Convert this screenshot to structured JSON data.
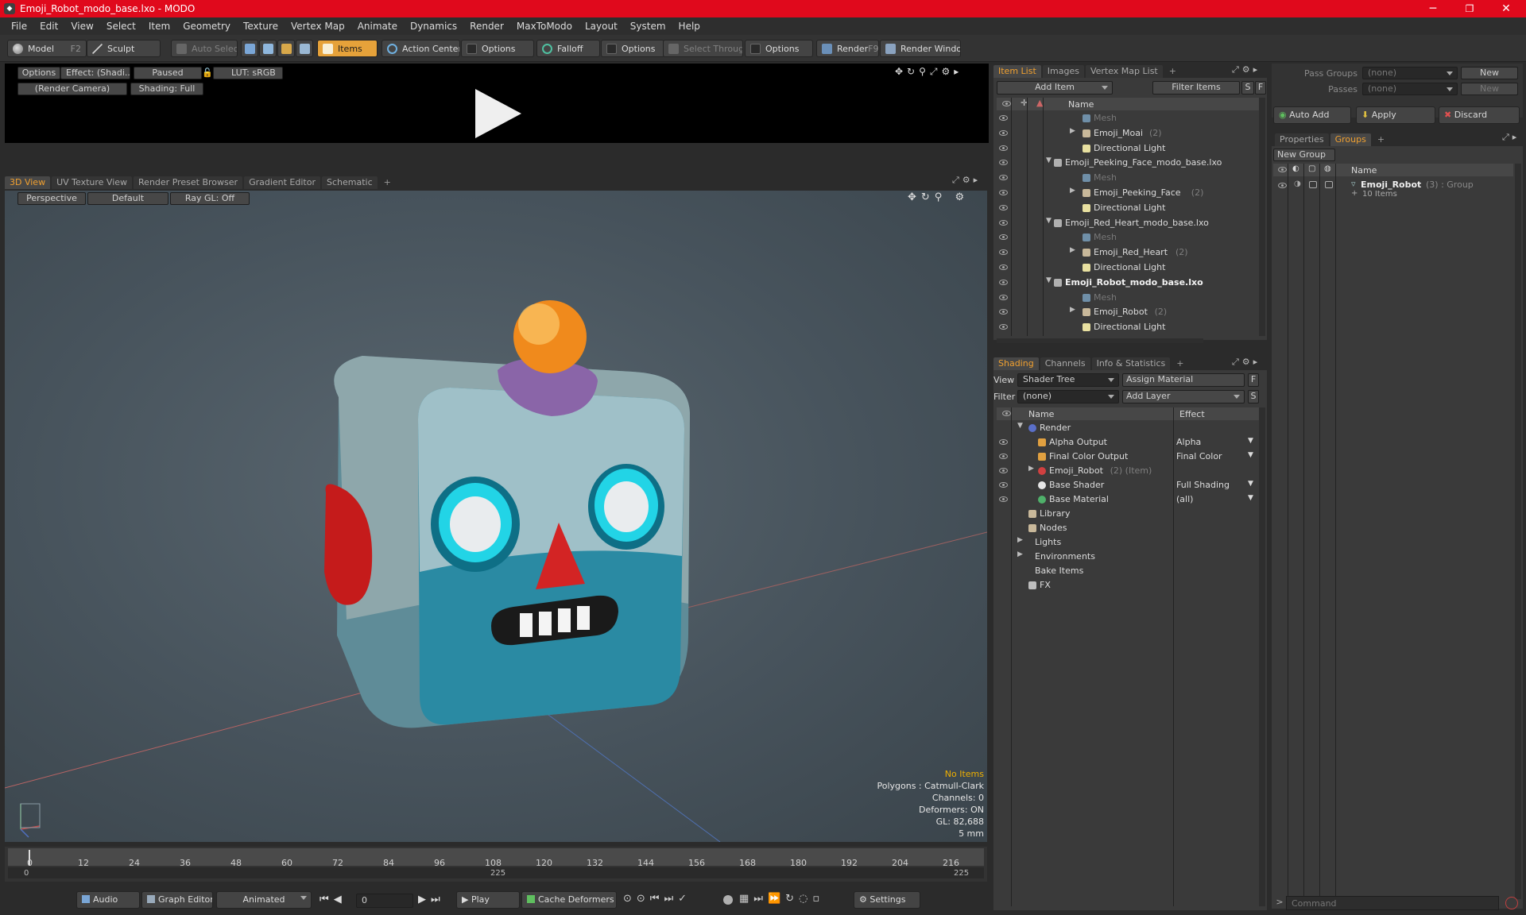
{
  "window": {
    "title": "Emoji_Robot_modo_base.lxo - MODO",
    "minimize": "─",
    "maximize": "❐",
    "close": "✕"
  },
  "menu": [
    "File",
    "Edit",
    "View",
    "Select",
    "Item",
    "Geometry",
    "Texture",
    "Vertex Map",
    "Animate",
    "Dynamics",
    "Render",
    "MaxToModo",
    "Layout",
    "System",
    "Help"
  ],
  "toolbar": {
    "model": "Model",
    "model_key": "F2",
    "sculpt": "Sculpt",
    "auto_select": "Auto Select",
    "items": "Items",
    "action_center": "Action Center",
    "options1": "Options",
    "falloff": "Falloff",
    "options2": "Options",
    "select_through": "Select Through",
    "options3": "Options",
    "render": "Render",
    "render_key": "F9",
    "render_window": "Render Window"
  },
  "preview": {
    "options": "Options",
    "effect": "Effect: (Shadi...",
    "paused": "Paused",
    "lut": "LUT: sRGB",
    "camera": "(Render Camera)",
    "shading": "Shading: Full"
  },
  "viewport_tabs": [
    "3D View",
    "UV Texture View",
    "Render Preset Browser",
    "Gradient Editor",
    "Schematic",
    "+"
  ],
  "viewport": {
    "perspective": "Perspective",
    "default": "Default",
    "raygl": "Ray GL: Off",
    "hud": {
      "no_items": "No Items",
      "polygons": "Polygons : Catmull-Clark",
      "channels": "Channels: 0",
      "deformers": "Deformers: ON",
      "gl": "GL: 82,688",
      "scale": "5 mm"
    }
  },
  "timeline": {
    "ticks": [
      "0",
      "12",
      "24",
      "36",
      "48",
      "60",
      "72",
      "84",
      "96",
      "108",
      "120",
      "132",
      "144",
      "156",
      "168",
      "180",
      "192",
      "204",
      "216"
    ],
    "start": "0",
    "mid": "225",
    "end": "225"
  },
  "bottom": {
    "audio": "Audio",
    "graph_editor": "Graph Editor",
    "animated": "Animated",
    "frame": "0",
    "play": "Play",
    "cache": "Cache Deformers",
    "settings": "Settings"
  },
  "item_list": {
    "tabs": [
      "Item List",
      "Images",
      "Vertex Map List",
      "+"
    ],
    "add_item": "Add Item",
    "filter_items": "Filter Items",
    "s": "S",
    "f": "F",
    "col_name": "Name",
    "rows": [
      {
        "label": "Mesh",
        "indent": 2,
        "kind": "mesh",
        "gray": true
      },
      {
        "label": "Emoji_Moai",
        "suffix": "(2)",
        "indent": 2,
        "kind": "group",
        "arrow": true
      },
      {
        "label": "Directional Light",
        "indent": 2,
        "kind": "light"
      },
      {
        "label": "Emoji_Peeking_Face_modo_base.lxo",
        "indent": 1,
        "kind": "scene",
        "open": true
      },
      {
        "label": "Mesh",
        "indent": 2,
        "kind": "mesh",
        "gray": true
      },
      {
        "label": "Emoji_Peeking_Face",
        "suffix": "(2)",
        "indent": 2,
        "kind": "group",
        "arrow": true
      },
      {
        "label": "Directional Light",
        "indent": 2,
        "kind": "light"
      },
      {
        "label": "Emoji_Red_Heart_modo_base.lxo",
        "indent": 1,
        "kind": "scene",
        "open": true
      },
      {
        "label": "Mesh",
        "indent": 2,
        "kind": "mesh",
        "gray": true
      },
      {
        "label": "Emoji_Red_Heart",
        "suffix": "(2)",
        "indent": 2,
        "kind": "group",
        "arrow": true
      },
      {
        "label": "Directional Light",
        "indent": 2,
        "kind": "light"
      },
      {
        "label": "Emoji_Robot_modo_base.lxo",
        "indent": 1,
        "kind": "scene",
        "open": true,
        "bold": true
      },
      {
        "label": "Mesh",
        "indent": 2,
        "kind": "mesh",
        "gray": true
      },
      {
        "label": "Emoji_Robot",
        "suffix": "(2)",
        "indent": 2,
        "kind": "group",
        "arrow": true
      },
      {
        "label": "Directional Light",
        "indent": 2,
        "kind": "light"
      }
    ]
  },
  "shading": {
    "tabs": [
      "Shading",
      "Channels",
      "Info & Statistics",
      "+"
    ],
    "view_label": "View",
    "view_value": "Shader Tree",
    "assign_material": "Assign Material",
    "filter_label": "Filter",
    "filter_value": "(none)",
    "add_layer": "Add Layer",
    "f": "F",
    "s": "S",
    "col_name": "Name",
    "col_effect": "Effect",
    "rows": [
      {
        "label": "Render",
        "effect": "",
        "indent": 0,
        "kind": "render",
        "open": true,
        "eye": false
      },
      {
        "label": "Alpha Output",
        "effect": "Alpha",
        "indent": 1,
        "kind": "output",
        "eye": true
      },
      {
        "label": "Final Color Output",
        "effect": "Final Color",
        "indent": 1,
        "kind": "output",
        "eye": true
      },
      {
        "label": "Emoji_Robot",
        "suffix": "(2) (Item)",
        "effect": "",
        "indent": 1,
        "kind": "mask",
        "arrow": true,
        "eye": true
      },
      {
        "label": "Base Shader",
        "effect": "Full Shading",
        "indent": 1,
        "kind": "shader",
        "eye": true
      },
      {
        "label": "Base Material",
        "effect": "(all)",
        "indent": 1,
        "kind": "material",
        "eye": true
      },
      {
        "label": "Library",
        "effect": "",
        "indent": 0,
        "kind": "folder",
        "eye": false
      },
      {
        "label": "Nodes",
        "effect": "",
        "indent": 0,
        "kind": "folder",
        "eye": false
      },
      {
        "label": "Lights",
        "effect": "",
        "indent": -1,
        "kind": "none",
        "arrow": true,
        "eye": false
      },
      {
        "label": "Environments",
        "effect": "",
        "indent": -1,
        "kind": "none",
        "arrow": true,
        "eye": false
      },
      {
        "label": "Bake Items",
        "effect": "",
        "indent": -1,
        "kind": "none",
        "eye": false
      },
      {
        "label": "FX",
        "effect": "",
        "indent": 0,
        "kind": "fx",
        "eye": false
      }
    ]
  },
  "groups": {
    "pass_groups_label": "Pass Groups",
    "pass_groups_value": "(none)",
    "passes_label": "Passes",
    "passes_value": "(none)",
    "new": "New",
    "new2": "New",
    "auto_add": "Auto Add",
    "apply": "Apply",
    "discard": "Discard",
    "tabs": [
      "Properties",
      "Groups",
      "+"
    ],
    "new_group": "New Group",
    "col_name": "Name",
    "group_name": "Emoji_Robot",
    "group_suffix": "(3) : Group",
    "group_items": "10 Items"
  },
  "command": {
    "placeholder": "Command",
    "prompt": ">"
  },
  "colors": {
    "title_bar": "#e0091c",
    "accent": "#f0a030",
    "robot_body": "#2a8aa3",
    "robot_nose": "#d32424"
  }
}
